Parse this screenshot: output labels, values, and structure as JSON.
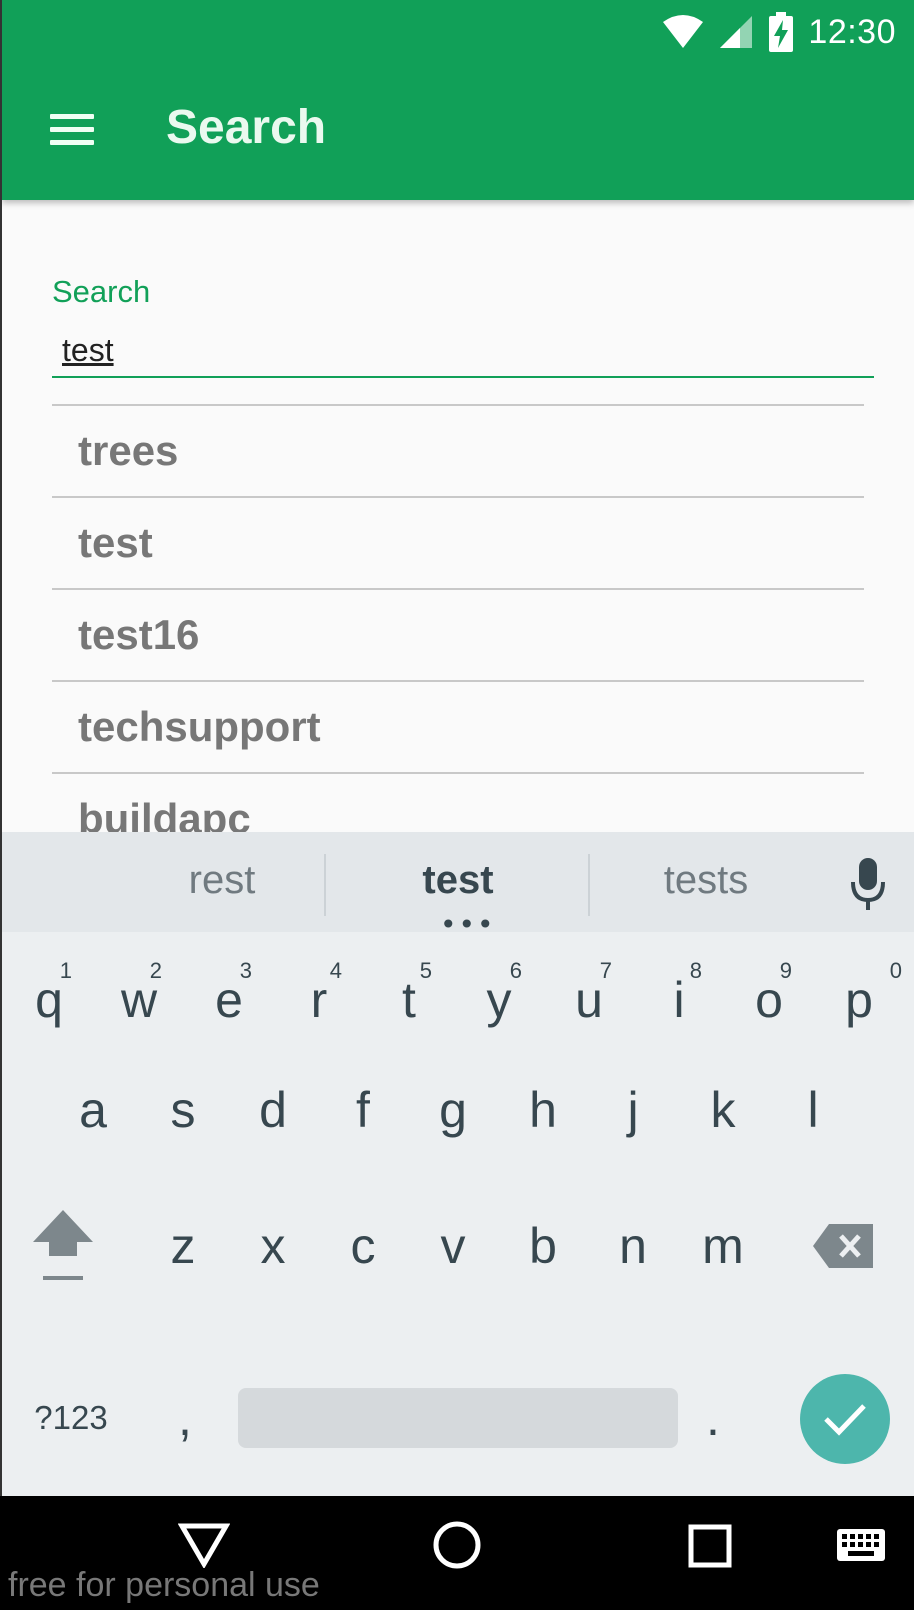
{
  "status_bar": {
    "time": "12:30",
    "icons": [
      "wifi-icon",
      "signal-icon",
      "battery-charging-icon"
    ]
  },
  "app_bar": {
    "title": "Search",
    "menu_icon": "hamburger-menu-icon"
  },
  "search": {
    "label": "Search",
    "value": "test"
  },
  "suggestions": [
    "trees",
    "test",
    "test16",
    "techsupport",
    "buildapc"
  ],
  "keyboard": {
    "suggestions": [
      "rest",
      "test",
      "tests"
    ],
    "row1": [
      {
        "key": "q",
        "hint": "1"
      },
      {
        "key": "w",
        "hint": "2"
      },
      {
        "key": "e",
        "hint": "3"
      },
      {
        "key": "r",
        "hint": "4"
      },
      {
        "key": "t",
        "hint": "5"
      },
      {
        "key": "y",
        "hint": "6"
      },
      {
        "key": "u",
        "hint": "7"
      },
      {
        "key": "i",
        "hint": "8"
      },
      {
        "key": "o",
        "hint": "9"
      },
      {
        "key": "p",
        "hint": "0"
      }
    ],
    "row2": [
      "a",
      "s",
      "d",
      "f",
      "g",
      "h",
      "j",
      "k",
      "l"
    ],
    "row3": [
      "z",
      "x",
      "c",
      "v",
      "b",
      "n",
      "m"
    ],
    "symbols_label": "?123",
    "comma": ",",
    "period": "."
  },
  "watermark": "free for personal use",
  "colors": {
    "primary": "#11a058",
    "keyboard_bg": "#eceff1",
    "enter": "#4db6ac",
    "nav_bg": "#000000"
  }
}
